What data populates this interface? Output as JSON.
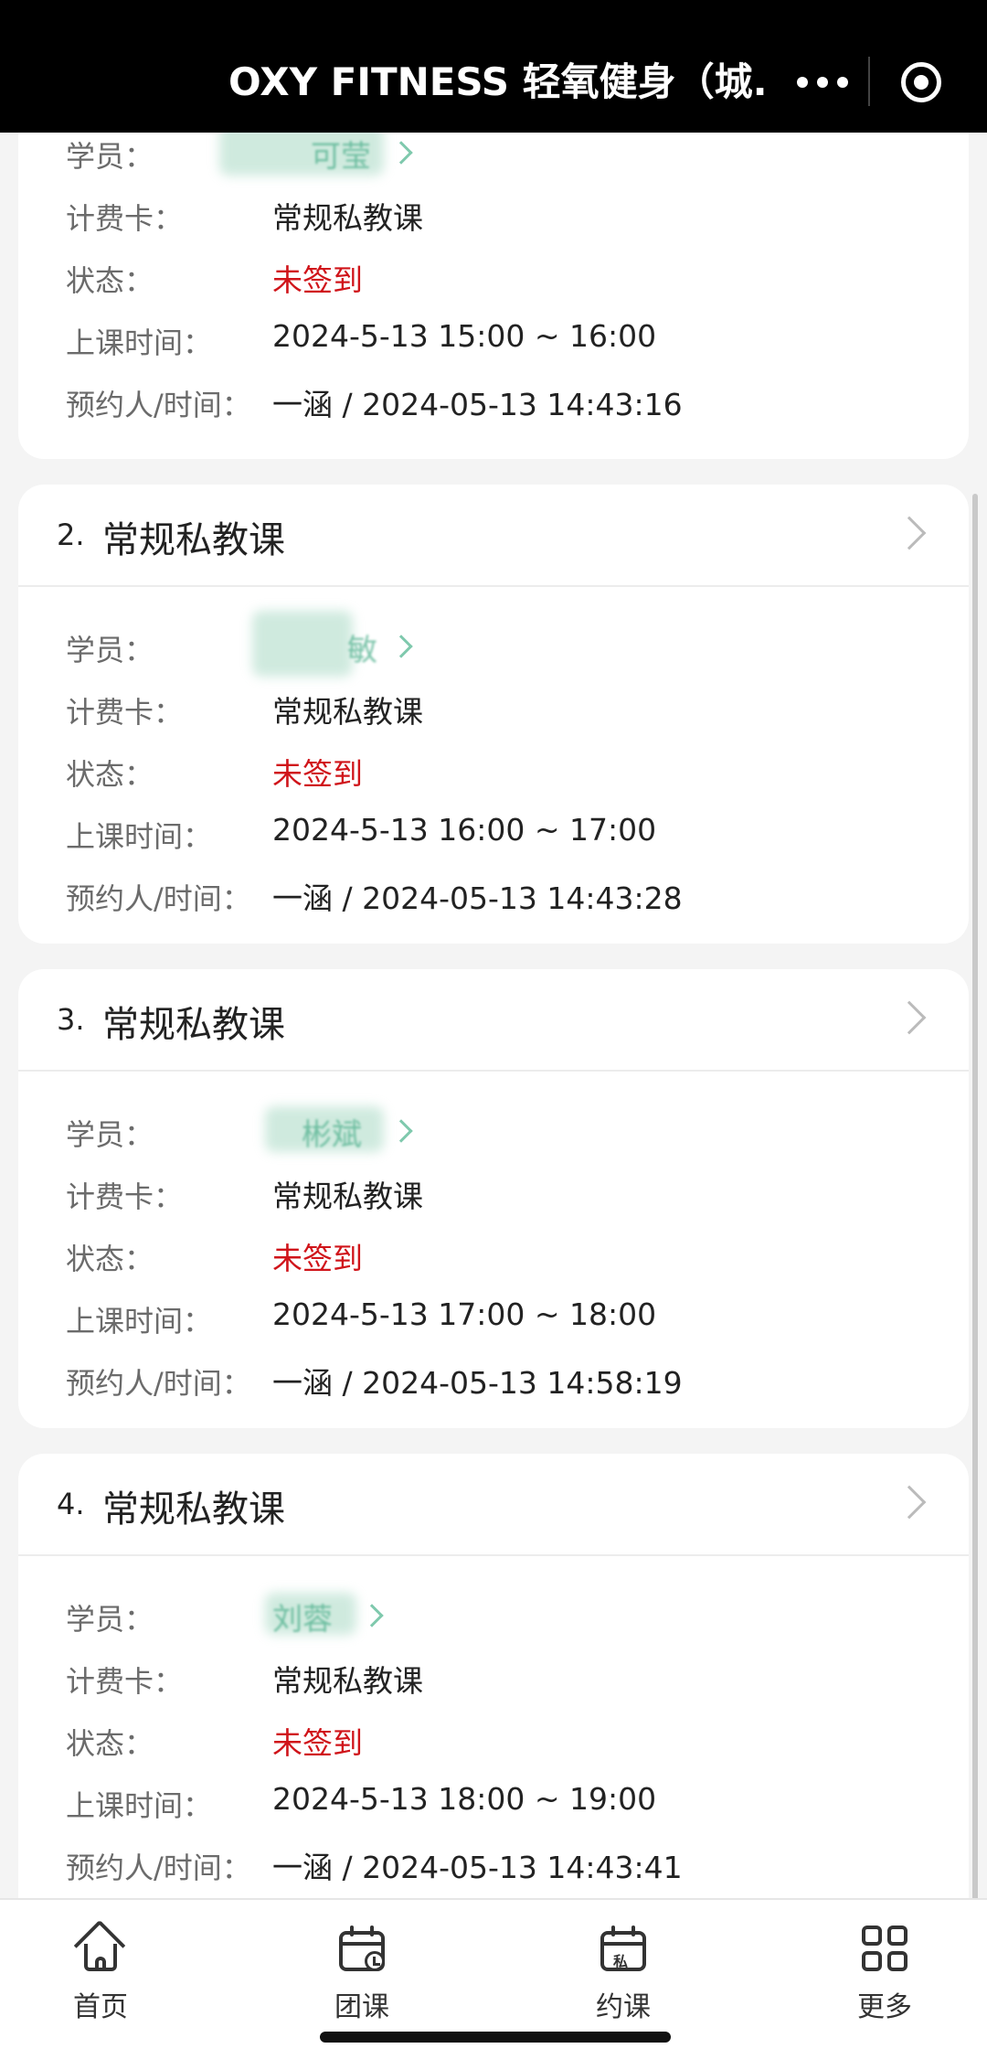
{
  "header": {
    "title": "OXY FITNESS 轻氧健身（城..."
  },
  "labels": {
    "student": "学员：",
    "card": "计费卡：",
    "status": "状态：",
    "class_time": "上课时间：",
    "booker_time": "预约人/时间："
  },
  "bookings": [
    {
      "index": "",
      "course": "",
      "student": "可莹",
      "card": "常规私教课",
      "status": "未签到",
      "class_time": "2024-5-13  15:00 ~ 16:00",
      "booker_time": "一涵 / 2024-05-13 14:43:16"
    },
    {
      "index": "2.",
      "course": "常规私教课",
      "student": "敏",
      "card": "常规私教课",
      "status": "未签到",
      "class_time": "2024-5-13  16:00 ~ 17:00",
      "booker_time": "一涵 / 2024-05-13 14:43:28"
    },
    {
      "index": "3.",
      "course": "常规私教课",
      "student": "彬斌",
      "card": "常规私教课",
      "status": "未签到",
      "class_time": "2024-5-13  17:00 ~ 18:00",
      "booker_time": "一涵 / 2024-05-13 14:58:19"
    },
    {
      "index": "4.",
      "course": "常规私教课",
      "student": "刘蓉",
      "card": "常规私教课",
      "status": "未签到",
      "class_time": "2024-5-13  18:00 ~ 19:00",
      "booker_time": "一涵 / 2024-05-13 14:43:41"
    }
  ],
  "tabbar": {
    "home": "首页",
    "group": "团课",
    "booking": "约课",
    "booking_icon_text": "私",
    "more": "更多"
  },
  "colors": {
    "status_red": "#d0141a",
    "student_green": "#4fb08d",
    "topbar": "#000000"
  }
}
